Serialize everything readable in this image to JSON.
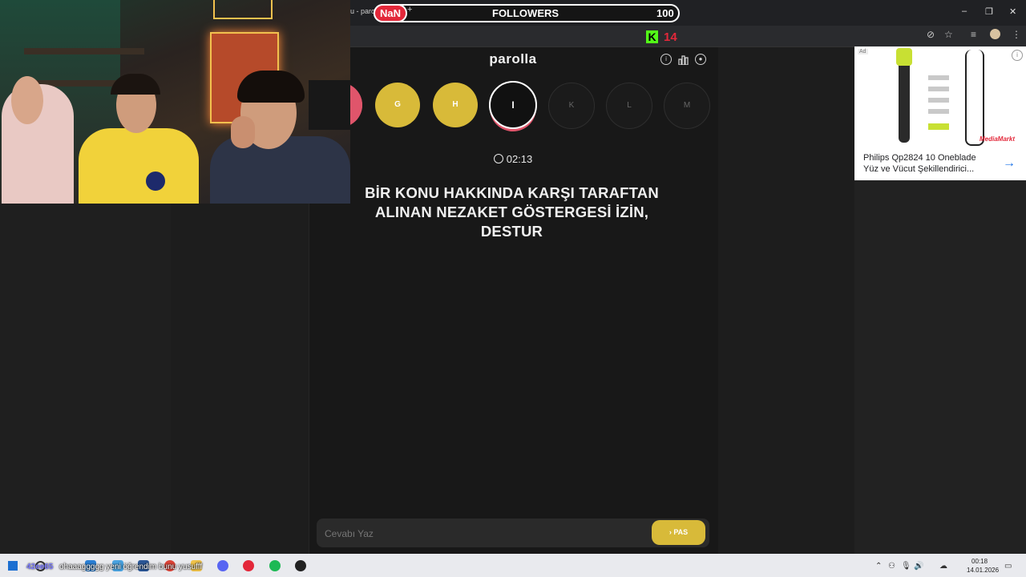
{
  "browser": {
    "tab_title": "u - paro",
    "minimize": "–",
    "restore": "❐",
    "close": "✕"
  },
  "overlay": {
    "nan_label": "NaN",
    "plus": "+",
    "followers_label": "FOLLOWERS",
    "followers_count": "100",
    "kick_logo": "K",
    "kick_count": "14"
  },
  "game": {
    "title": "parolla",
    "header_icons": [
      "info-icon",
      "stats-icon",
      "user-icon"
    ],
    "letters": [
      {
        "char": "",
        "state": "wrong"
      },
      {
        "char": "G",
        "state": "passed"
      },
      {
        "char": "H",
        "state": "passed"
      },
      {
        "char": "I",
        "state": "current"
      },
      {
        "char": "K",
        "state": "future"
      },
      {
        "char": "L",
        "state": "future"
      },
      {
        "char": "M",
        "state": "future"
      }
    ],
    "timer": "02:13",
    "question": "BİR KONU HAKKINDA KARŞI TARAFTAN ALINAN NEZAKET GÖSTERGESİ İZİN, DESTUR",
    "answer_placeholder": "Cevabı Yaz",
    "pass_label": "PAS"
  },
  "ad": {
    "text": "Philips Qp2824 10 Oneblade Yüz ve Vücut Şekillendirici...",
    "brand": "MediaMarkt",
    "badge": "Ad"
  },
  "taskbar": {
    "chat_user": "42ee65",
    "chat_message": "ohaaaggggg yeni öğrendim bunu yusufff",
    "time": "00:18",
    "date": "14.01.2026"
  },
  "colors": {
    "passed": "#d8ba39",
    "wrong": "#e0556b",
    "accent_red": "#e3283a",
    "kick_green": "#53fc18"
  }
}
